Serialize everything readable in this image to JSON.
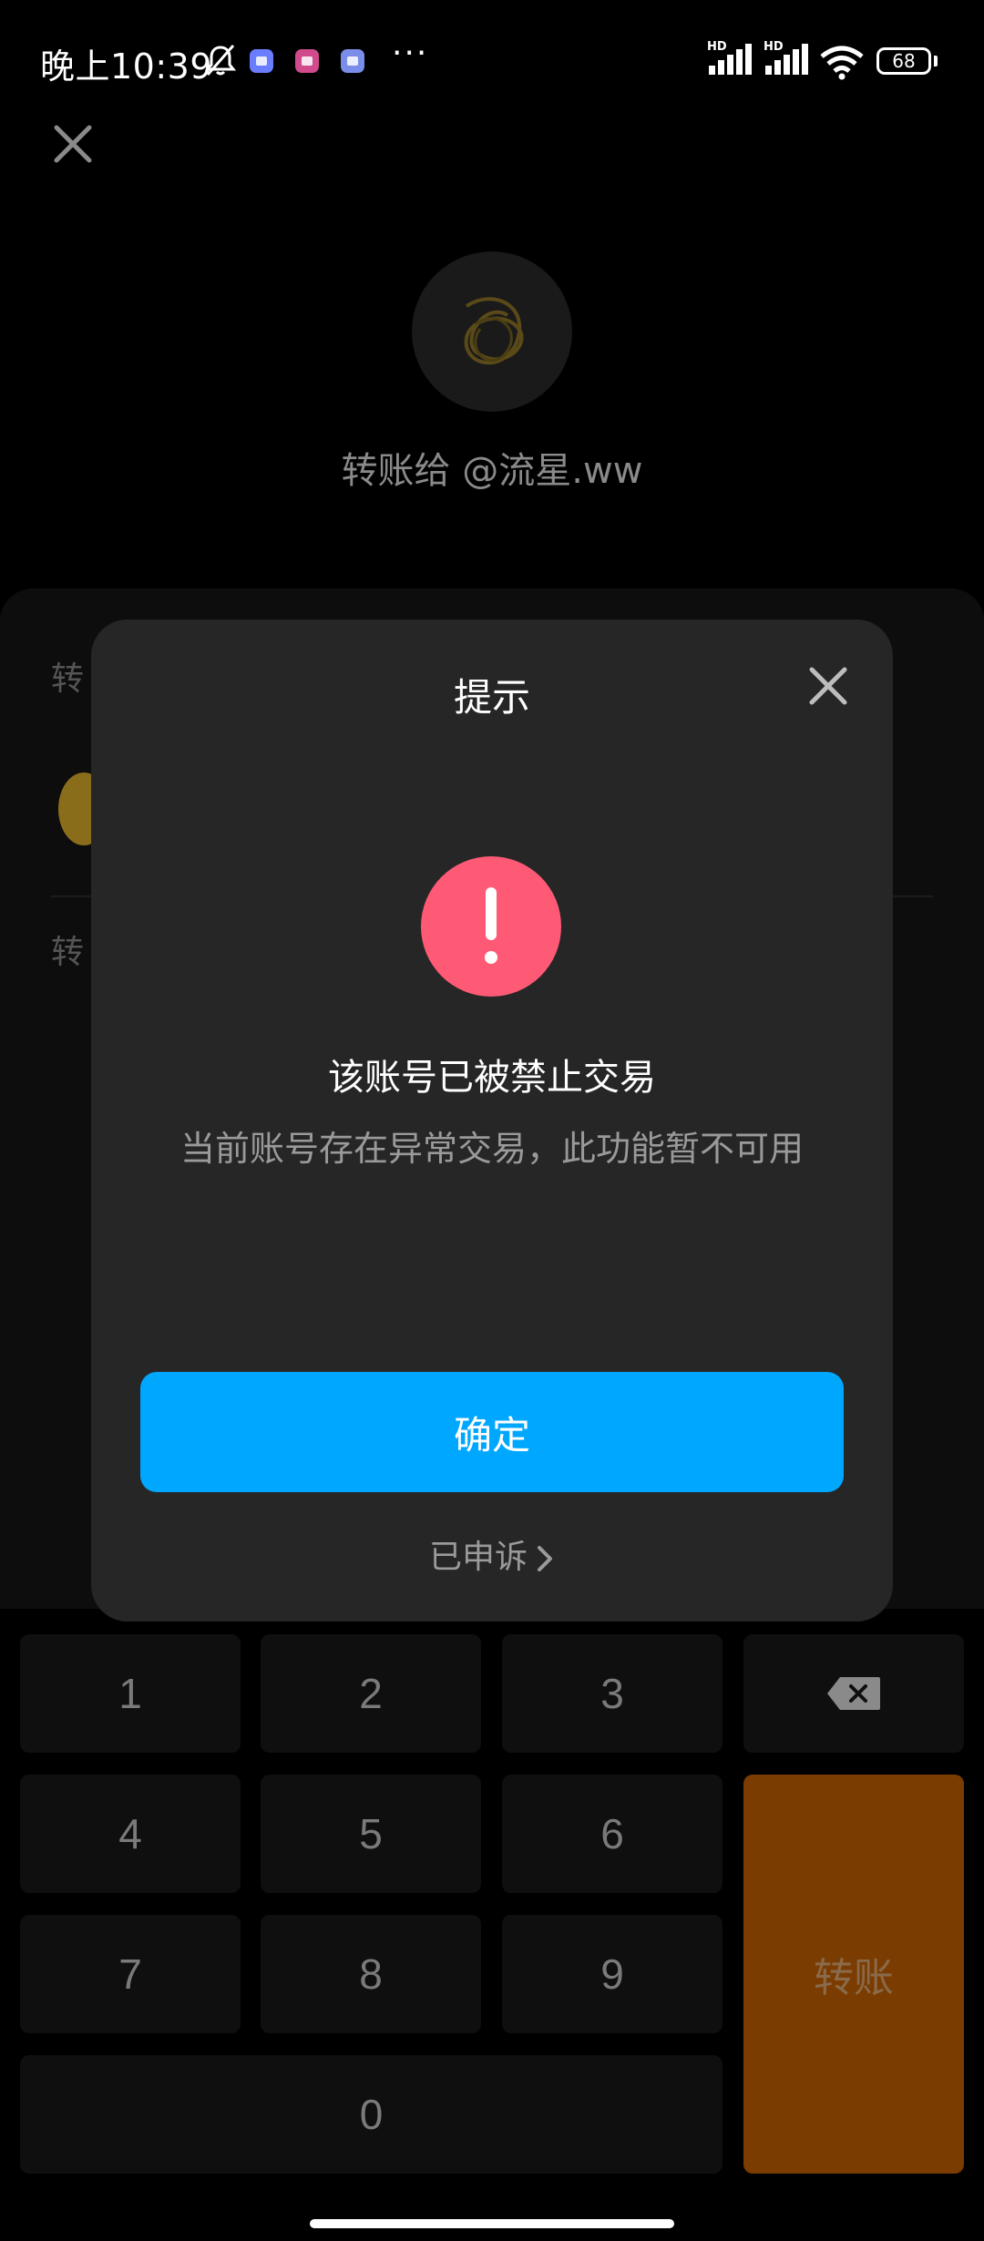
{
  "status_bar": {
    "time": "晚上10:39",
    "more": "···",
    "hd1": "HD",
    "hd2": "HD",
    "battery": "68"
  },
  "header": {
    "close_icon": "close-icon",
    "recipient": "转账给 @流星.ww"
  },
  "panel": {
    "amount_label": "转",
    "note_label": "转"
  },
  "modal": {
    "title": "提示",
    "close_icon": "close-icon",
    "alert_icon": "exclamation-icon",
    "heading": "该账号已被禁止交易",
    "message": "当前账号存在异常交易，此功能暂不可用",
    "confirm_label": "确定",
    "appeal_label": "已申诉",
    "accent_color": "#00a7ff",
    "alert_color": "#ff5a75"
  },
  "keypad": {
    "keys": [
      "1",
      "2",
      "3",
      "4",
      "5",
      "6",
      "7",
      "8",
      "9",
      "0"
    ],
    "backspace_icon": "backspace-icon",
    "transfer_label": "转账",
    "transfer_color": "#7a3c00"
  }
}
